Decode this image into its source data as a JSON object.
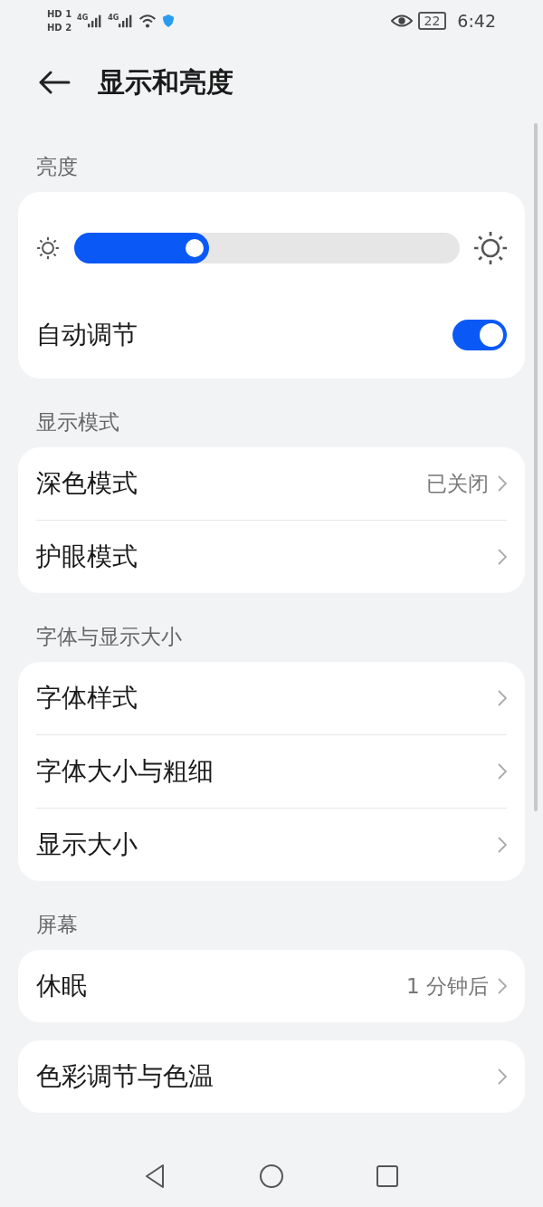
{
  "status_bar": {
    "sims": [
      {
        "badge": "HD",
        "slot": "1",
        "network": "4G"
      },
      {
        "badge": "HD",
        "slot": "2",
        "network": "4G"
      }
    ],
    "battery": "22",
    "time": "6:42"
  },
  "header": {
    "title": "显示和亮度"
  },
  "sections": [
    {
      "title": "亮度",
      "items": [
        {
          "kind": "slider",
          "level": 0.35
        },
        {
          "kind": "toggle",
          "label": "自动调节",
          "on": true
        }
      ]
    },
    {
      "title": "显示模式",
      "items": [
        {
          "kind": "link",
          "label": "深色模式",
          "value": "已关闭"
        },
        {
          "kind": "link",
          "label": "护眼模式"
        }
      ]
    },
    {
      "title": "字体与显示大小",
      "items": [
        {
          "kind": "link",
          "label": "字体样式"
        },
        {
          "kind": "link",
          "label": "字体大小与粗细"
        },
        {
          "kind": "link",
          "label": "显示大小"
        }
      ]
    },
    {
      "title": "屏幕",
      "items": [
        {
          "kind": "link",
          "label": "休眠",
          "value": "1 分钟后"
        }
      ]
    },
    {
      "items": [
        {
          "kind": "link",
          "label": "色彩调节与色温"
        }
      ]
    }
  ]
}
